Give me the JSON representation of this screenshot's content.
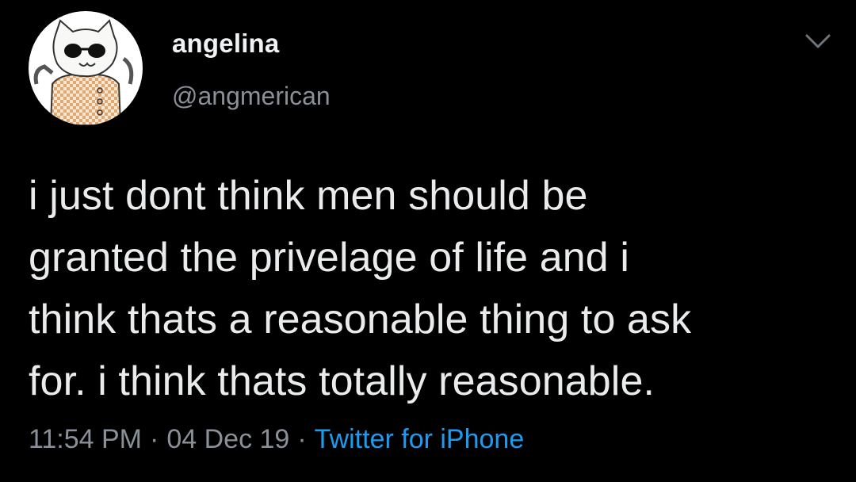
{
  "user": {
    "display_name": "angelina",
    "handle": "@angmerican"
  },
  "tweet": {
    "text": "i just dont think men should be\ngranted the privelage of life and i\nthink thats a reasonable thing to ask\nfor. i think thats totally reasonable."
  },
  "meta": {
    "time": "11:54 PM",
    "date": "04 Dec 19",
    "separator": "·",
    "source": "Twitter for iPhone"
  },
  "icons": {
    "avatar": "cat-avatar-icon",
    "menu": "chevron-down-icon"
  },
  "colors": {
    "background": "#000000",
    "text": "#e9ebed",
    "muted": "#8a9098",
    "link": "#1d9bf0"
  }
}
